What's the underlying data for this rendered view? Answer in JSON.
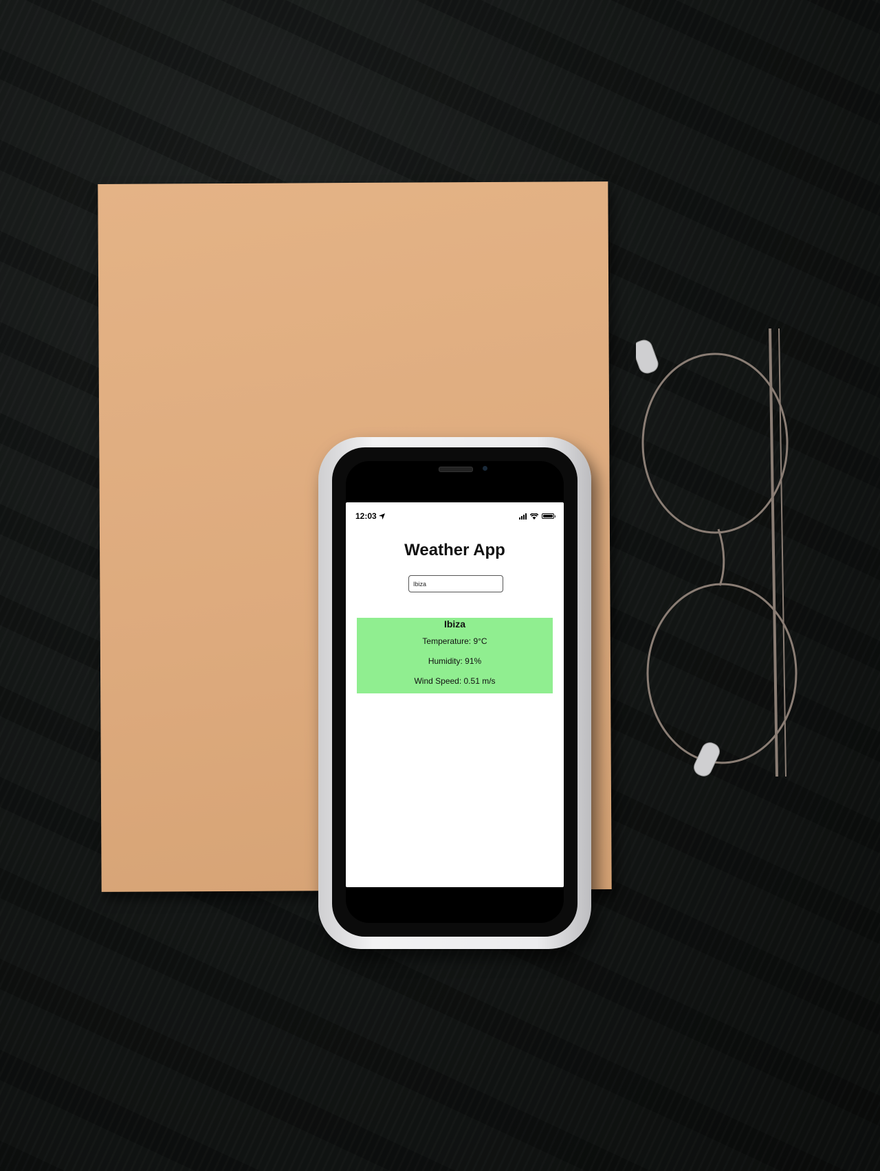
{
  "status_bar": {
    "time": "12:03",
    "location_icon": "location-arrow-icon",
    "icons": [
      "cellular-signal-icon",
      "wifi-icon",
      "battery-icon"
    ]
  },
  "app": {
    "title": "Weather App",
    "search": {
      "value": "Ibiza",
      "placeholder": ""
    },
    "weather": {
      "city": "Ibiza",
      "temperature": "Temperature: 9°C",
      "humidity": "Humidity: 91%",
      "wind_speed": "Wind Speed: 0.51 m/s",
      "card_color": "#90ee90"
    }
  },
  "colors": {
    "background": "#141716",
    "paper": "#deac7f",
    "phone_case": "#ececee",
    "screen": "#ffffff"
  }
}
